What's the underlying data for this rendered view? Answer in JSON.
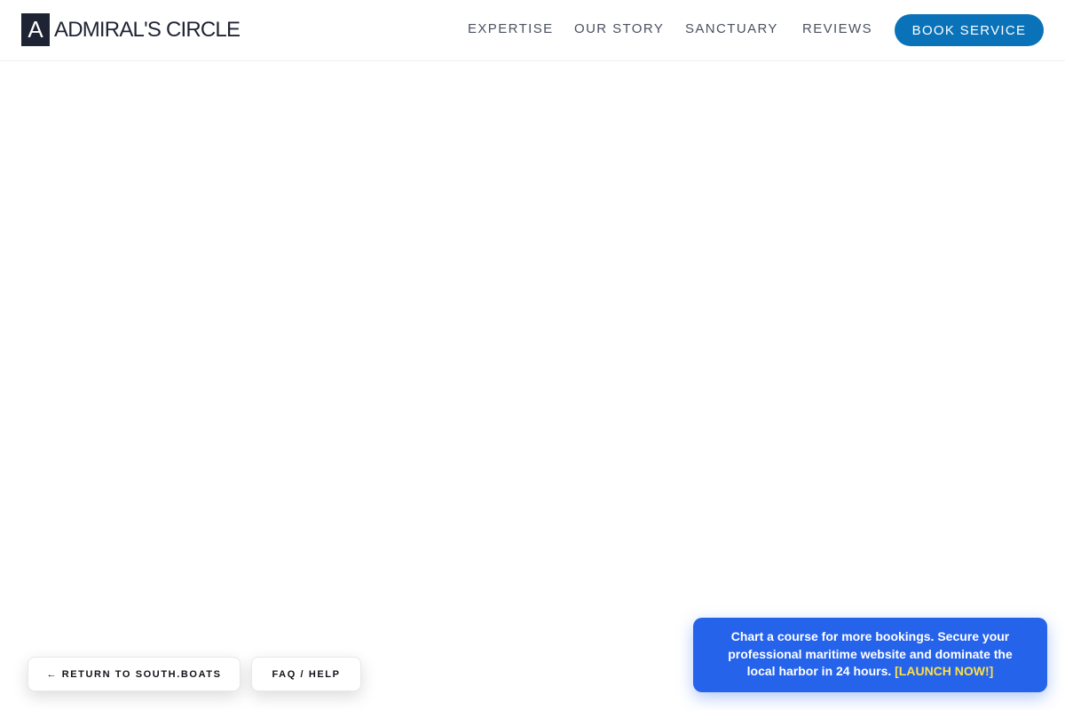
{
  "brand": {
    "mark": "A",
    "name": "ADMIRAL'S CIRCLE"
  },
  "nav": {
    "items": [
      {
        "label": "EXPERTISE"
      },
      {
        "label": "OUR STORY"
      },
      {
        "label": "SANCTUARY"
      },
      {
        "label": "REVIEWS"
      }
    ],
    "cta_label": "BOOK SERVICE"
  },
  "floating": {
    "return_label": "← RETURN TO SOUTH.BOATS",
    "faq_label": "FAQ / HELP"
  },
  "promo": {
    "text": "Chart a course for more bookings. Secure your professional maritime website and dominate the local harbor in 24 hours.",
    "cta_label": "[LAUNCH NOW!]"
  },
  "colors": {
    "brand_dark": "#1e2433",
    "primary_blue": "#0a72b8",
    "promo_blue": "#2563eb",
    "promo_highlight": "#fde047"
  }
}
